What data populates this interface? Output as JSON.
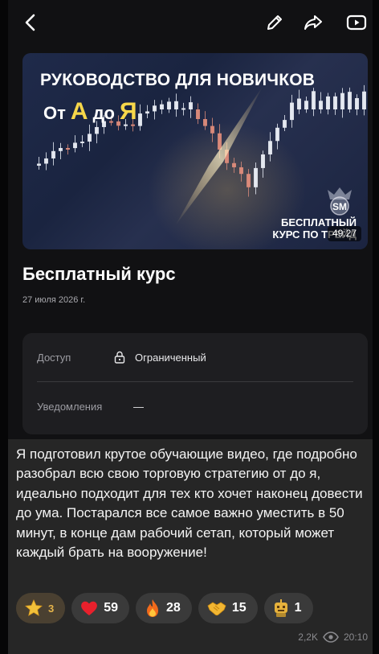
{
  "video": {
    "headline": "РУКОВОДСТВО ДЛЯ НОВИЧКОВ",
    "sub_from": "От",
    "sub_a": "А",
    "sub_to": "до",
    "sub_ya": "Я",
    "badge_line1": "БЕСПЛАТНЫЙ",
    "badge_line2": "КУРС ПО ТРЕЙД",
    "logo_text": "SM",
    "duration": "49:27"
  },
  "post": {
    "title": "Бесплатный курс",
    "date": "27 июля 2026 г.",
    "access_label": "Доступ",
    "access_value": "Ограниченный",
    "notify_label": "Уведомления",
    "notify_value": "—",
    "text": "Я подготовил крутое обучающие видео, где подробно разобрал всю свою торговую стратегию от до я, идеально подходит для тех кто хочет наконец довести до ума. Постарался все самое важно уместить в 50 минут, в конце дам рабочий сетап, который может каждый брать на вооружение!"
  },
  "reactions": [
    {
      "icon": "star-icon",
      "count": "3"
    },
    {
      "icon": "heart-icon",
      "count": "59"
    },
    {
      "icon": "fire-icon",
      "count": "28"
    },
    {
      "icon": "handshake-icon",
      "count": "15"
    },
    {
      "icon": "robot-icon",
      "count": "1"
    }
  ],
  "meta": {
    "views": "2,2K",
    "time": "20:10"
  },
  "colors": {
    "accent_gold": "#f7d74a",
    "card_bg": "#1e1e21",
    "text_block_bg": "#262626"
  }
}
